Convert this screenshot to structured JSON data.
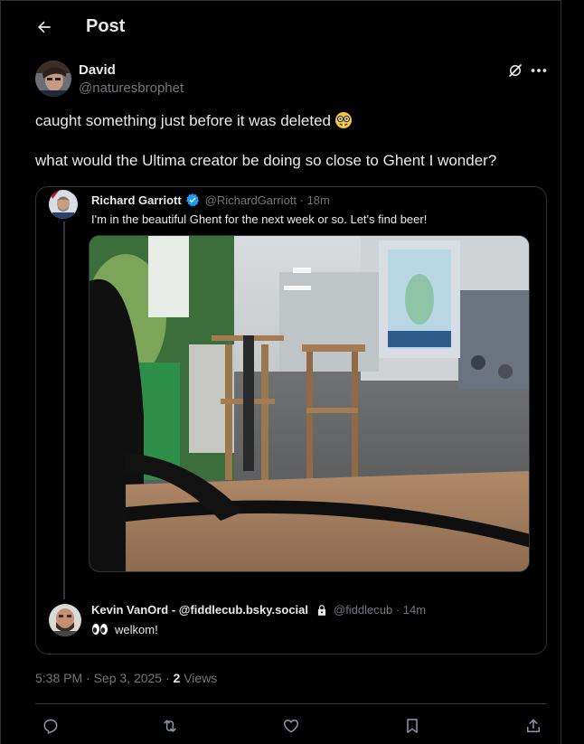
{
  "header": {
    "title": "Post",
    "back_icon": "arrow-left-icon"
  },
  "post": {
    "author_name": "David",
    "author_handle": "@naturesbrophet",
    "text_line1": "caught something just before it was deleted",
    "text_line1_emoji": "nerd-face-emoji",
    "text_line2": "what would the Ultima creator be doing so close to Ghent I wonder?",
    "timestamp": "5:38 PM · Sep 3, 2025 · ",
    "views_count": "2",
    "views_label": " Views"
  },
  "quote": {
    "first": {
      "name": "Richard Garriott",
      "handle_time": "@RichardGarriott · 18m",
      "text": "I'm in the beautiful Ghent for the next week or so. Let's find beer!",
      "verified_color": "#1d9bf0"
    },
    "second": {
      "name": "Kevin VanOrd - @fiddlecub.bsky.social",
      "handle_time": "@fiddlecub · 14m",
      "text": "welkom!",
      "emoji": "eyes-emoji"
    }
  },
  "actions": [
    "reply-icon",
    "repost-icon",
    "like-icon",
    "bookmark-icon",
    "share-icon"
  ],
  "colors": {
    "background": "#000000",
    "text": "#e7e9ea",
    "muted": "#71767b",
    "border": "#2f3336",
    "accent": "#1d9bf0"
  }
}
